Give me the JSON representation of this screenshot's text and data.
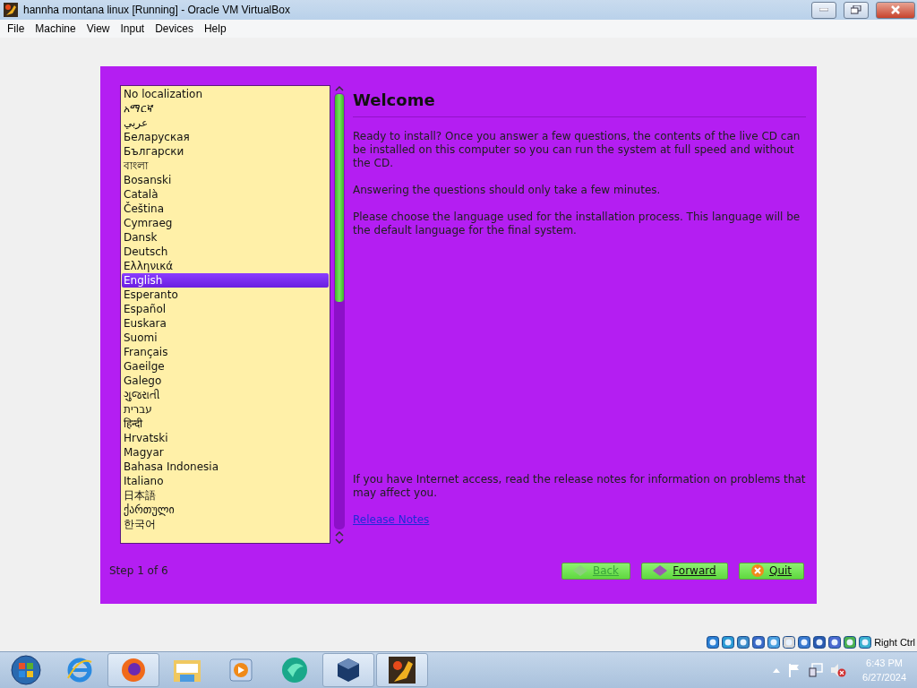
{
  "window": {
    "title": "hannha montana linux [Running] - Oracle VM VirtualBox"
  },
  "menu": [
    "File",
    "Machine",
    "View",
    "Input",
    "Devices",
    "Help"
  ],
  "installer": {
    "languages": [
      {
        "label": "No localization",
        "selected": false
      },
      {
        "label": "አማርኛ",
        "selected": false
      },
      {
        "label": "عربي",
        "selected": false
      },
      {
        "label": "Беларуская",
        "selected": false
      },
      {
        "label": "Български",
        "selected": false
      },
      {
        "label": "বাংলা",
        "selected": false
      },
      {
        "label": "Bosanski",
        "selected": false
      },
      {
        "label": "Català",
        "selected": false
      },
      {
        "label": "Čeština",
        "selected": false
      },
      {
        "label": "Cymraeg",
        "selected": false
      },
      {
        "label": "Dansk",
        "selected": false
      },
      {
        "label": "Deutsch",
        "selected": false
      },
      {
        "label": "Ελληνικά",
        "selected": false
      },
      {
        "label": "English",
        "selected": true
      },
      {
        "label": "Esperanto",
        "selected": false
      },
      {
        "label": "Español",
        "selected": false
      },
      {
        "label": "Euskara",
        "selected": false
      },
      {
        "label": "Suomi",
        "selected": false
      },
      {
        "label": "Français",
        "selected": false
      },
      {
        "label": "Gaeilge",
        "selected": false
      },
      {
        "label": "Galego",
        "selected": false
      },
      {
        "label": "ગુજરાતી",
        "selected": false
      },
      {
        "label": "עברית",
        "selected": false
      },
      {
        "label": "हिन्दी",
        "selected": false
      },
      {
        "label": "Hrvatski",
        "selected": false
      },
      {
        "label": "Magyar",
        "selected": false
      },
      {
        "label": "Bahasa Indonesia",
        "selected": false
      },
      {
        "label": "Italiano",
        "selected": false
      },
      {
        "label": "日本語",
        "selected": false
      },
      {
        "label": "ქართული",
        "selected": false
      },
      {
        "label": "한국어",
        "selected": false
      }
    ],
    "heading": "Welcome",
    "paragraphs": [
      "Ready to install? Once you answer a few questions, the contents of the live CD can be installed on this computer so you can run the system at full speed and without the CD.",
      "Answering the questions should only take a few minutes.",
      "Please choose the language used for the installation process. This language will be the default language for the final system."
    ],
    "release_text": "If you have Internet access, read the release notes for information on problems that may affect you.",
    "release_link": "Release Notes",
    "step": "Step 1 of 6",
    "buttons": [
      {
        "kind": "back",
        "label": "Back",
        "disabled": true
      },
      {
        "kind": "forward",
        "label": "Forward",
        "disabled": false
      },
      {
        "kind": "quit",
        "label": "Quit",
        "disabled": false
      }
    ]
  },
  "status_bar": {
    "host_key": "Right Ctrl"
  },
  "clock": {
    "time": "6:43 PM",
    "date": "6/27/2024"
  }
}
